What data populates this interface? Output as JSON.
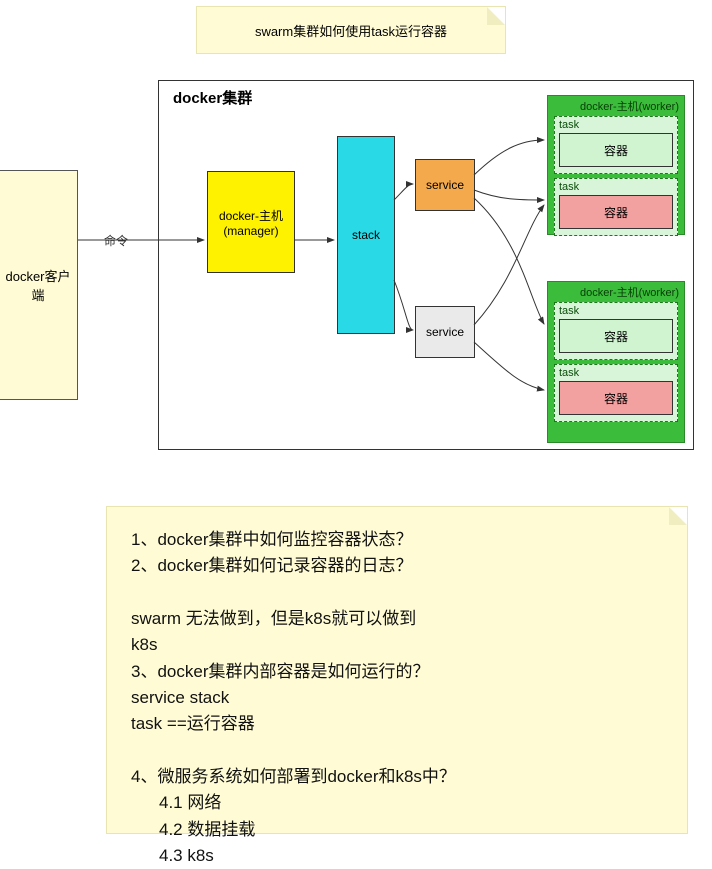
{
  "title": "swarm集群如何使用task运行容器",
  "client": "docker客户端",
  "edgeLabel": "命令",
  "cluster": "docker集群",
  "manager": "docker-主机(manager)",
  "stack": "stack",
  "service1": "service",
  "service2": "service",
  "worker1": {
    "label": "docker-主机(worker)",
    "tasks": [
      {
        "task": "task",
        "container": "容器",
        "color": "green"
      },
      {
        "task": "task",
        "container": "容器",
        "color": "red"
      }
    ]
  },
  "worker2": {
    "label": "docker-主机(worker)",
    "tasks": [
      {
        "task": "task",
        "container": "容器",
        "color": "green"
      },
      {
        "task": "task",
        "container": "容器",
        "color": "red"
      }
    ]
  },
  "notes": {
    "l1": "1、docker集群中如何监控容器状态？",
    "l2": "2、docker集群如何记录容器的日志？",
    "l3": "swarm 无法做到，但是k8s就可以做到",
    "l4": "k8s",
    "l5": "3、docker集群内部容器是如何运行的？",
    "l6": "service stack",
    "l7": "task ==运行容器",
    "l8": "4、微服务系统如何部署到docker和k8s中？",
    "l9": "4.1 网络",
    "l10": "4.2 数据挂载",
    "l11": "4.3 k8s"
  }
}
